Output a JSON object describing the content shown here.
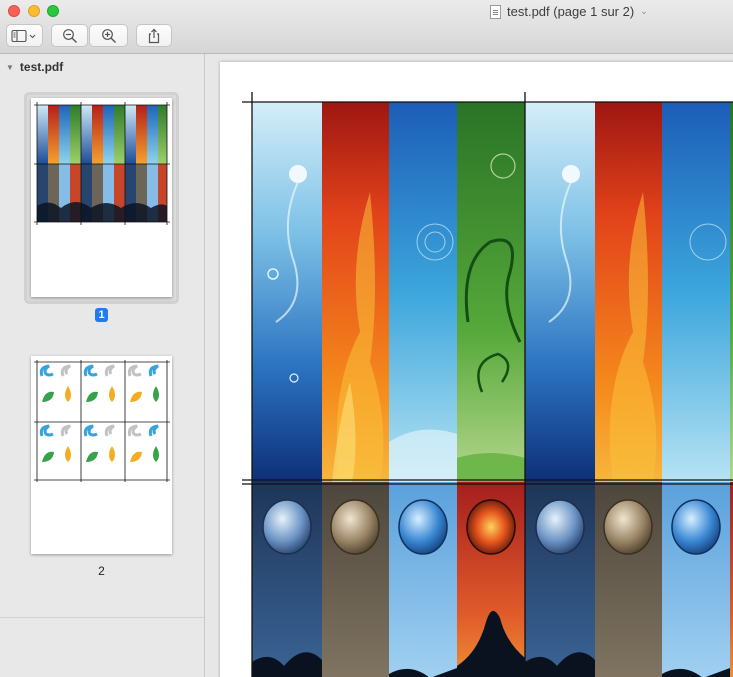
{
  "window": {
    "title": "test.pdf (page 1 sur 2)"
  },
  "sidebar": {
    "header": "test.pdf",
    "pages": [
      {
        "number": "1",
        "selected": true
      },
      {
        "number": "2",
        "selected": false
      }
    ]
  },
  "toolbar": {
    "buttons": [
      "sidebar-toggle",
      "zoom-out",
      "zoom-in",
      "share"
    ]
  },
  "colors": {
    "selection_badge": "#1c7cf4",
    "air_panel": "#7fc2e8",
    "fire_panel": "#f06a1a",
    "water_panel": "#2a8fd1",
    "earth_panel": "#4aa23a"
  }
}
